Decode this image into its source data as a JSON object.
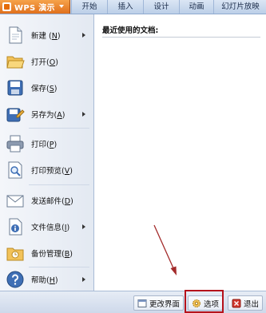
{
  "app": {
    "title": "WPS 演示"
  },
  "ribbon": {
    "tabs": [
      "开始",
      "插入",
      "设计",
      "动画",
      "幻灯片放映"
    ]
  },
  "menu": {
    "items": [
      {
        "label": "新建",
        "key": "N",
        "icon": "new-document-icon",
        "submenu": true
      },
      {
        "label": "打开",
        "key": "O",
        "icon": "open-folder-icon",
        "submenu": false
      },
      {
        "label": "保存",
        "key": "S",
        "icon": "save-disk-icon",
        "submenu": false
      },
      {
        "label": "另存为",
        "key": "A",
        "icon": "save-as-icon",
        "submenu": true
      },
      {
        "label": "打印",
        "key": "P",
        "icon": "printer-icon",
        "submenu": false
      },
      {
        "label": "打印预览",
        "key": "V",
        "icon": "print-preview-icon",
        "submenu": false
      },
      {
        "label": "发送邮件",
        "key": "D",
        "icon": "mail-icon",
        "submenu": false
      },
      {
        "label": "文件信息",
        "key": "I",
        "icon": "file-info-icon",
        "submenu": true
      },
      {
        "label": "备份管理",
        "key": "B",
        "icon": "backup-icon",
        "submenu": false
      },
      {
        "label": "帮助",
        "key": "H",
        "icon": "help-icon",
        "submenu": true
      }
    ]
  },
  "recent": {
    "title": "最近使用的文档:"
  },
  "footer": {
    "change_ui_label": "更改界面",
    "options_label": "选项",
    "exit_label": "退出"
  },
  "colors": {
    "accent": "#e46c0a",
    "highlight": "#b5121b"
  }
}
